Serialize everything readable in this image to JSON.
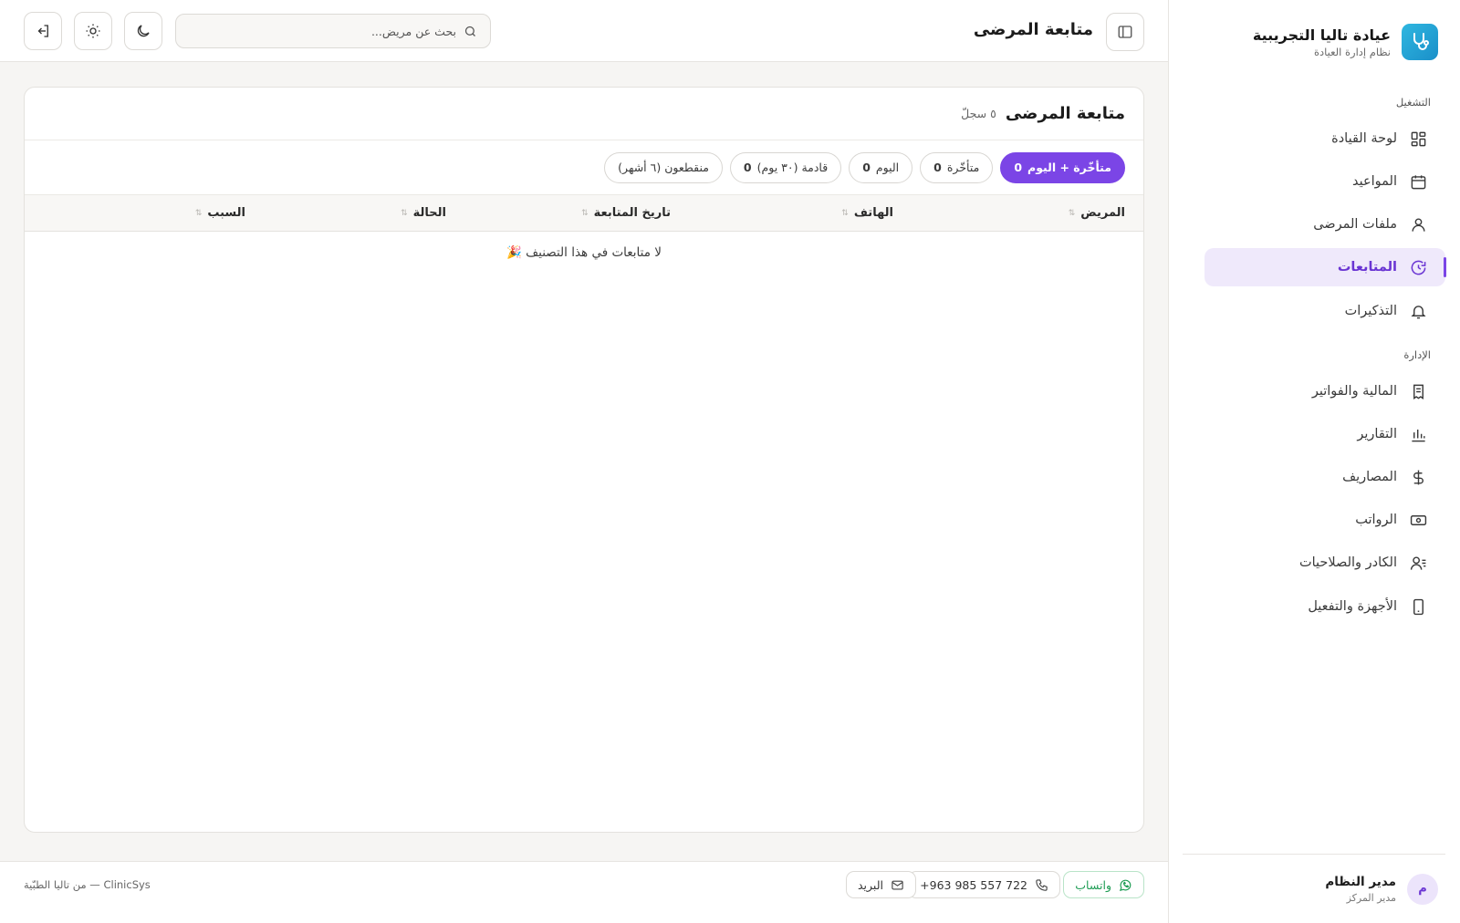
{
  "brand": {
    "name": "عيادة تاليا التجريبية",
    "subtitle": "نظام إدارة العيادة"
  },
  "sidebar": {
    "section_ops": "التشغيل",
    "section_admin": "الإدارة",
    "items": [
      {
        "label": "لوحة القيادة",
        "icon": "grid-icon"
      },
      {
        "label": "المواعيد",
        "icon": "calendar-icon"
      },
      {
        "label": "ملفات المرضى",
        "icon": "user-icon"
      },
      {
        "label": "المتابعات",
        "icon": "refresh-clock-icon",
        "active": true
      },
      {
        "label": "التذكيرات",
        "icon": "bell-icon"
      },
      {
        "label": "المالية والفواتير",
        "icon": "receipt-icon"
      },
      {
        "label": "التقارير",
        "icon": "bar-chart-icon"
      },
      {
        "label": "المصاريف",
        "icon": "dollar-icon"
      },
      {
        "label": "الرواتب",
        "icon": "banknote-icon"
      },
      {
        "label": "الكادر والصلاحيات",
        "icon": "users-list-icon"
      },
      {
        "label": "الأجهزة والتفعيل",
        "icon": "smartphone-icon"
      }
    ]
  },
  "user": {
    "initial": "م",
    "name": "مدير النظام",
    "role": "مدير المركز"
  },
  "header": {
    "title": "متابعة المرضى",
    "search_placeholder": "بحث عن مريض..."
  },
  "card": {
    "title": "متابعة المرضى",
    "count": "٥ سجلّ",
    "filters": [
      {
        "label": "متأخّرة + اليوم",
        "count": "0",
        "active": true
      },
      {
        "label": "متأخّرة",
        "count": "0"
      },
      {
        "label": "اليوم",
        "count": "0"
      },
      {
        "label": "قادمة (٣٠ يوم)",
        "count": "0"
      },
      {
        "label": "منقطعون (٦ أشهر)",
        "count": ""
      }
    ],
    "columns": [
      "المريض",
      "الهاتف",
      "تاريخ المتابعة",
      "الحالة",
      "السبب"
    ],
    "empty_message": "لا متابعات في هذا التصنيف 🎉"
  },
  "footer": {
    "whatsapp": "واتساب",
    "phone": "+963 985 557 722",
    "email": "البريد",
    "note": "ClinicSys — من تاليا الطبّية"
  },
  "colors": {
    "accent": "#7b45e6",
    "accent_soft": "#efe9fb",
    "whatsapp": "#1f9d55",
    "brand_logo": "#1a8fc9"
  }
}
